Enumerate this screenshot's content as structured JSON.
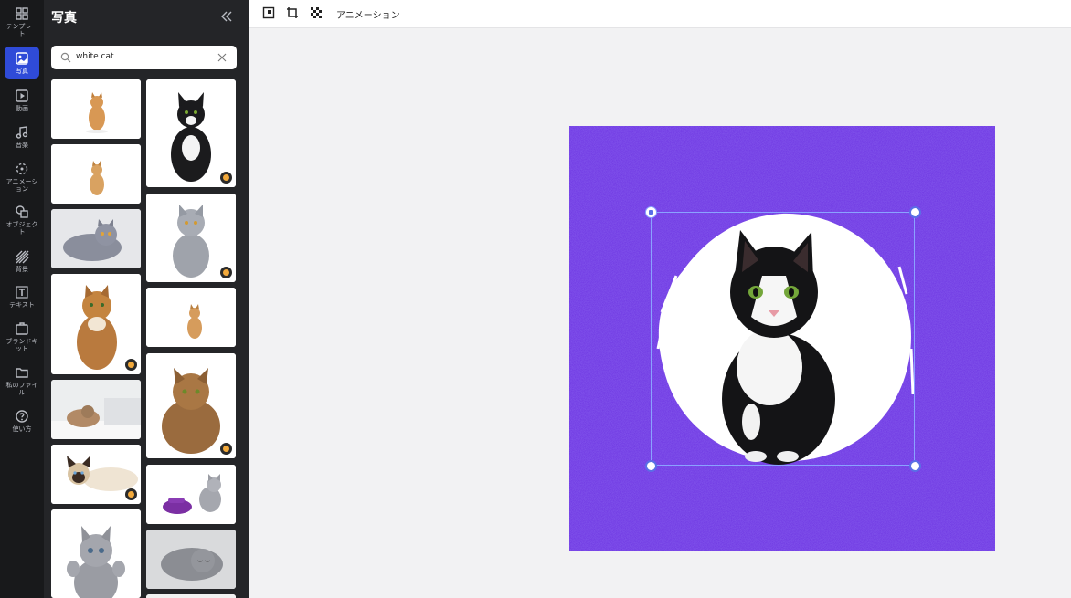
{
  "rail": {
    "items": [
      {
        "label": "テンプレート",
        "icon": "grid-icon"
      },
      {
        "label": "写真",
        "icon": "photo-icon",
        "active": true
      },
      {
        "label": "動画",
        "icon": "video-icon"
      },
      {
        "label": "音楽",
        "icon": "music-icon"
      },
      {
        "label": "アニメーション",
        "icon": "animation-icon"
      },
      {
        "label": "オブジェクト",
        "icon": "shapes-icon"
      },
      {
        "label": "背景",
        "icon": "background-icon"
      },
      {
        "label": "テキスト",
        "icon": "text-icon"
      },
      {
        "label": "ブランドキット",
        "icon": "briefcase-icon"
      },
      {
        "label": "私のファイル",
        "icon": "folder-icon"
      },
      {
        "label": "使い方",
        "icon": "help-icon"
      }
    ]
  },
  "panel": {
    "title": "写真",
    "search": {
      "value": "white cat",
      "placeholder": ""
    },
    "results": [
      {
        "desc": "orange cat sitting",
        "premium": false
      },
      {
        "desc": "black and white cat",
        "premium": true
      },
      {
        "desc": "orange cat small",
        "premium": false
      },
      {
        "desc": "grey british cat",
        "premium": true
      },
      {
        "desc": "grey cat lying",
        "premium": false
      },
      {
        "desc": "orange kitten",
        "premium": false
      },
      {
        "desc": "tabby cat sitting",
        "premium": true
      },
      {
        "desc": "fluffy brown cat",
        "premium": true
      },
      {
        "desc": "cat on bed with laptop",
        "premium": false
      },
      {
        "desc": "kitten with phone",
        "premium": false
      },
      {
        "desc": "siamese cat lying",
        "premium": true
      },
      {
        "desc": "grey cat sleeping",
        "premium": false
      },
      {
        "desc": "grey kitten paws up",
        "premium": false
      }
    ]
  },
  "toolbar": {
    "animation_label": "アニメーション"
  },
  "colors": {
    "canvas_bg": "#6a2ee0",
    "accent": "#2f4bd8",
    "premium_badge": "#f2a93b"
  }
}
